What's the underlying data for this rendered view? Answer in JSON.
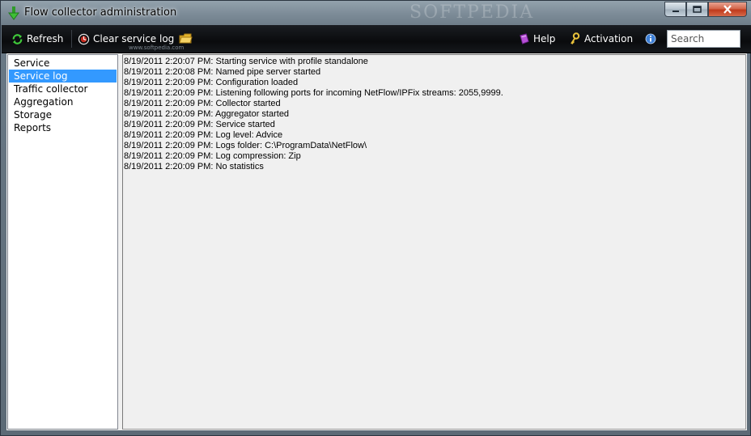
{
  "window": {
    "title": "Flow collector administration",
    "watermark": "SOFTPEDIA"
  },
  "toolbar": {
    "refresh_label": "Refresh",
    "clear_log_label": "Clear service log",
    "help_label": "Help",
    "activation_label": "Activation",
    "search_placeholder": "Search",
    "softpedia_url": "www.softpedia.com"
  },
  "sidebar": {
    "items": [
      {
        "label": "Service",
        "selected": false
      },
      {
        "label": "Service log",
        "selected": true
      },
      {
        "label": "Traffic collector",
        "selected": false
      },
      {
        "label": "Aggregation",
        "selected": false
      },
      {
        "label": "Storage",
        "selected": false
      },
      {
        "label": "Reports",
        "selected": false
      }
    ]
  },
  "log": {
    "lines": [
      "8/19/2011 2:20:07 PM: Starting service with profile standalone",
      "8/19/2011 2:20:08 PM: Named pipe server started",
      "8/19/2011 2:20:09 PM: Configuration loaded",
      "8/19/2011 2:20:09 PM: Listening following ports for incoming NetFlow/IPFix streams: 2055,9999.",
      "8/19/2011 2:20:09 PM: Collector started",
      "8/19/2011 2:20:09 PM: Aggregator started",
      "8/19/2011 2:20:09 PM: Service started",
      "8/19/2011 2:20:09 PM: Log level: Advice",
      "8/19/2011 2:20:09 PM: Logs folder: C:\\ProgramData\\NetFlow\\",
      "8/19/2011 2:20:09 PM: Log compression: Zip",
      "8/19/2011 2:20:09 PM: No statistics"
    ]
  },
  "colors": {
    "selection": "#3399ff",
    "toolbar_bg": "#0a0b0d",
    "close_button": "#c0391b"
  },
  "icons": {
    "app": "green-arrow-icon",
    "refresh": "refresh-icon",
    "clear": "clear-log-icon",
    "folder": "folder-icon",
    "help": "help-book-icon",
    "activation": "key-icon",
    "info": "info-icon"
  }
}
